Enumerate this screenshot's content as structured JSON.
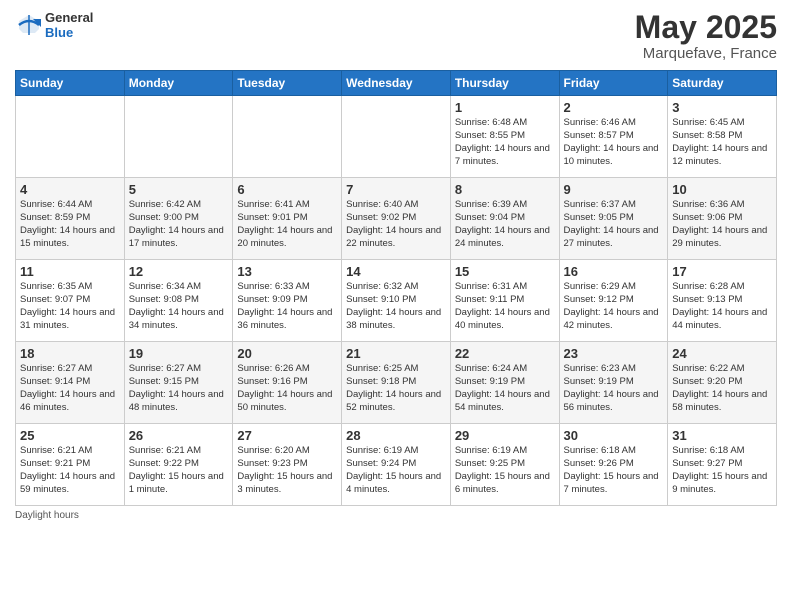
{
  "header": {
    "logo": {
      "general": "General",
      "blue": "Blue"
    },
    "title": "May 2025",
    "subtitle": "Marquefave, France"
  },
  "calendar": {
    "days_of_week": [
      "Sunday",
      "Monday",
      "Tuesday",
      "Wednesday",
      "Thursday",
      "Friday",
      "Saturday"
    ],
    "weeks": [
      [
        {
          "day": "",
          "info": ""
        },
        {
          "day": "",
          "info": ""
        },
        {
          "day": "",
          "info": ""
        },
        {
          "day": "",
          "info": ""
        },
        {
          "day": "1",
          "info": "Sunrise: 6:48 AM\nSunset: 8:55 PM\nDaylight: 14 hours and 7 minutes."
        },
        {
          "day": "2",
          "info": "Sunrise: 6:46 AM\nSunset: 8:57 PM\nDaylight: 14 hours and 10 minutes."
        },
        {
          "day": "3",
          "info": "Sunrise: 6:45 AM\nSunset: 8:58 PM\nDaylight: 14 hours and 12 minutes."
        }
      ],
      [
        {
          "day": "4",
          "info": "Sunrise: 6:44 AM\nSunset: 8:59 PM\nDaylight: 14 hours and 15 minutes."
        },
        {
          "day": "5",
          "info": "Sunrise: 6:42 AM\nSunset: 9:00 PM\nDaylight: 14 hours and 17 minutes."
        },
        {
          "day": "6",
          "info": "Sunrise: 6:41 AM\nSunset: 9:01 PM\nDaylight: 14 hours and 20 minutes."
        },
        {
          "day": "7",
          "info": "Sunrise: 6:40 AM\nSunset: 9:02 PM\nDaylight: 14 hours and 22 minutes."
        },
        {
          "day": "8",
          "info": "Sunrise: 6:39 AM\nSunset: 9:04 PM\nDaylight: 14 hours and 24 minutes."
        },
        {
          "day": "9",
          "info": "Sunrise: 6:37 AM\nSunset: 9:05 PM\nDaylight: 14 hours and 27 minutes."
        },
        {
          "day": "10",
          "info": "Sunrise: 6:36 AM\nSunset: 9:06 PM\nDaylight: 14 hours and 29 minutes."
        }
      ],
      [
        {
          "day": "11",
          "info": "Sunrise: 6:35 AM\nSunset: 9:07 PM\nDaylight: 14 hours and 31 minutes."
        },
        {
          "day": "12",
          "info": "Sunrise: 6:34 AM\nSunset: 9:08 PM\nDaylight: 14 hours and 34 minutes."
        },
        {
          "day": "13",
          "info": "Sunrise: 6:33 AM\nSunset: 9:09 PM\nDaylight: 14 hours and 36 minutes."
        },
        {
          "day": "14",
          "info": "Sunrise: 6:32 AM\nSunset: 9:10 PM\nDaylight: 14 hours and 38 minutes."
        },
        {
          "day": "15",
          "info": "Sunrise: 6:31 AM\nSunset: 9:11 PM\nDaylight: 14 hours and 40 minutes."
        },
        {
          "day": "16",
          "info": "Sunrise: 6:29 AM\nSunset: 9:12 PM\nDaylight: 14 hours and 42 minutes."
        },
        {
          "day": "17",
          "info": "Sunrise: 6:28 AM\nSunset: 9:13 PM\nDaylight: 14 hours and 44 minutes."
        }
      ],
      [
        {
          "day": "18",
          "info": "Sunrise: 6:27 AM\nSunset: 9:14 PM\nDaylight: 14 hours and 46 minutes."
        },
        {
          "day": "19",
          "info": "Sunrise: 6:27 AM\nSunset: 9:15 PM\nDaylight: 14 hours and 48 minutes."
        },
        {
          "day": "20",
          "info": "Sunrise: 6:26 AM\nSunset: 9:16 PM\nDaylight: 14 hours and 50 minutes."
        },
        {
          "day": "21",
          "info": "Sunrise: 6:25 AM\nSunset: 9:18 PM\nDaylight: 14 hours and 52 minutes."
        },
        {
          "day": "22",
          "info": "Sunrise: 6:24 AM\nSunset: 9:19 PM\nDaylight: 14 hours and 54 minutes."
        },
        {
          "day": "23",
          "info": "Sunrise: 6:23 AM\nSunset: 9:19 PM\nDaylight: 14 hours and 56 minutes."
        },
        {
          "day": "24",
          "info": "Sunrise: 6:22 AM\nSunset: 9:20 PM\nDaylight: 14 hours and 58 minutes."
        }
      ],
      [
        {
          "day": "25",
          "info": "Sunrise: 6:21 AM\nSunset: 9:21 PM\nDaylight: 14 hours and 59 minutes."
        },
        {
          "day": "26",
          "info": "Sunrise: 6:21 AM\nSunset: 9:22 PM\nDaylight: 15 hours and 1 minute."
        },
        {
          "day": "27",
          "info": "Sunrise: 6:20 AM\nSunset: 9:23 PM\nDaylight: 15 hours and 3 minutes."
        },
        {
          "day": "28",
          "info": "Sunrise: 6:19 AM\nSunset: 9:24 PM\nDaylight: 15 hours and 4 minutes."
        },
        {
          "day": "29",
          "info": "Sunrise: 6:19 AM\nSunset: 9:25 PM\nDaylight: 15 hours and 6 minutes."
        },
        {
          "day": "30",
          "info": "Sunrise: 6:18 AM\nSunset: 9:26 PM\nDaylight: 15 hours and 7 minutes."
        },
        {
          "day": "31",
          "info": "Sunrise: 6:18 AM\nSunset: 9:27 PM\nDaylight: 15 hours and 9 minutes."
        }
      ]
    ],
    "footer": "Daylight hours"
  }
}
